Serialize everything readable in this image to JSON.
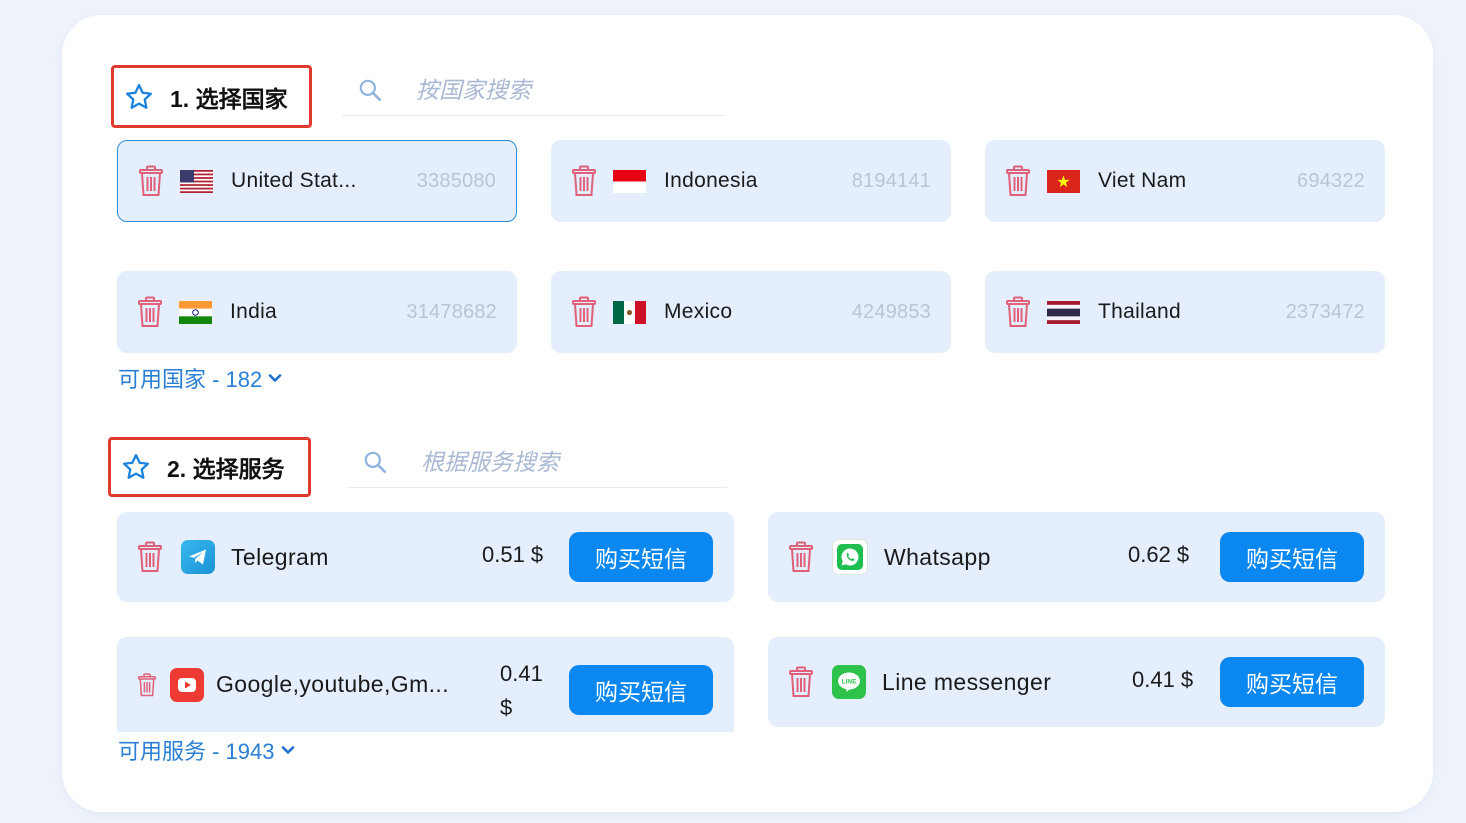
{
  "step1": {
    "title": "1. 选择国家",
    "search_placeholder": "按国家搜索",
    "countries": [
      {
        "name": "United Stat...",
        "count": "3385080",
        "flag": "us-flag",
        "selected": true
      },
      {
        "name": "Indonesia",
        "count": "8194141",
        "flag": "id-flag"
      },
      {
        "name": "Viet Nam",
        "count": "694322",
        "flag": "vn-flag"
      },
      {
        "name": "India",
        "count": "31478682",
        "flag": "in-flag"
      },
      {
        "name": "Mexico",
        "count": "4249853",
        "flag": "mx-flag"
      },
      {
        "name": "Thailand",
        "count": "2373472",
        "flag": "th-flag"
      }
    ],
    "available_link": "可用国家 - 182"
  },
  "step2": {
    "title": "2. 选择服务",
    "search_placeholder": "根据服务搜索",
    "services": [
      {
        "name": "Telegram",
        "price": "0.51 $",
        "button": "购买短信",
        "icon": "telegram-icon"
      },
      {
        "name": "Whatsapp",
        "price": "0.62 $",
        "button": "购买短信",
        "icon": "whatsapp-icon"
      },
      {
        "name": "Google,youtube,Gm...",
        "price": "0.41 $",
        "button": "购买短信",
        "icon": "youtube-icon"
      },
      {
        "name": "Line messenger",
        "price": "0.41 $",
        "button": "购买短信",
        "icon": "line-icon"
      }
    ],
    "available_link": "可用服务 - 1943"
  },
  "colors": {
    "accent": "#0a87f0",
    "highlight_border": "#e03a2f",
    "card_bg": "#e4eefc",
    "link": "#2a7fd4",
    "trash": "#e0607a"
  }
}
